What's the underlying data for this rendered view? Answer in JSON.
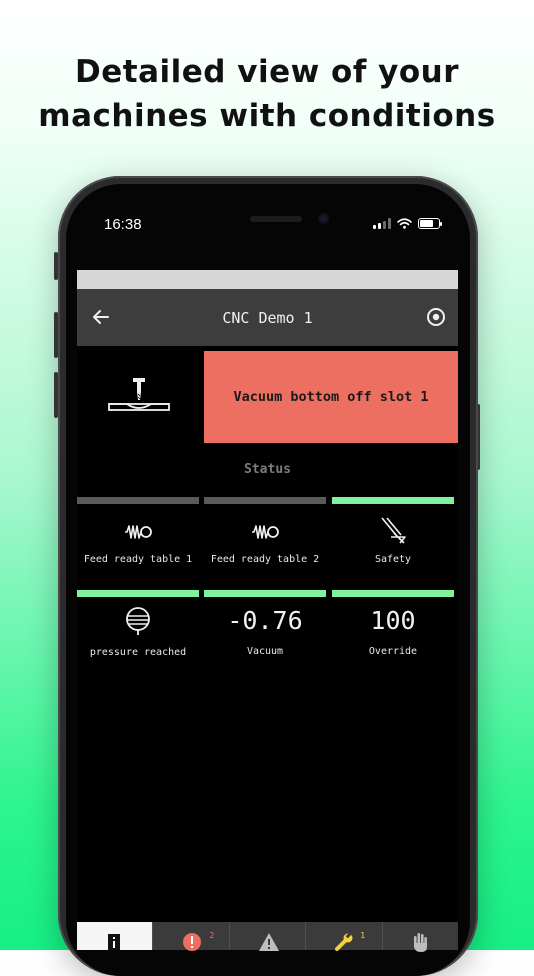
{
  "headline": {
    "line1": "Detailed view of your",
    "line2": "machines with conditions"
  },
  "status_bar": {
    "time": "16:38"
  },
  "header": {
    "title": "CNC Demo 1",
    "back_icon": "arrow-left-icon",
    "action_icon": "record-circle-icon"
  },
  "alert": {
    "message": "Vacuum bottom off slot 1",
    "color": "#ec6f62"
  },
  "status_section": {
    "label": "Status"
  },
  "status_tiles": [
    {
      "label": "Feed ready table 1",
      "icon": "spring-icon",
      "state_color": "#5a5a5a"
    },
    {
      "label": "Feed ready table 2",
      "icon": "spring-icon",
      "state_color": "#5a5a5a"
    },
    {
      "label": "Safety",
      "icon": "safety-icon",
      "state_color": "#7ef29c"
    },
    {
      "label": "pressure reached",
      "icon": "pressure-icon",
      "state_color": "#7ef29c"
    },
    {
      "label": "Vacuum",
      "value": "-0.76",
      "state_color": "#7ef29c"
    },
    {
      "label": "Override",
      "value": "100",
      "state_color": "#7ef29c"
    }
  ],
  "tabs": [
    {
      "name": "info",
      "icon": "info-icon",
      "active": true
    },
    {
      "name": "errors",
      "icon": "error-icon",
      "badge": "2",
      "badge_color": "#ec6f62"
    },
    {
      "name": "warnings",
      "icon": "warning-icon"
    },
    {
      "name": "maintenance",
      "icon": "wrench-icon",
      "badge": "1",
      "badge_color": "#f5d23a"
    },
    {
      "name": "manual",
      "icon": "hand-icon"
    }
  ],
  "colors": {
    "accent_green": "#7ef29c",
    "inactive_gray": "#5a5a5a",
    "header_bg": "#3d3d3d"
  }
}
